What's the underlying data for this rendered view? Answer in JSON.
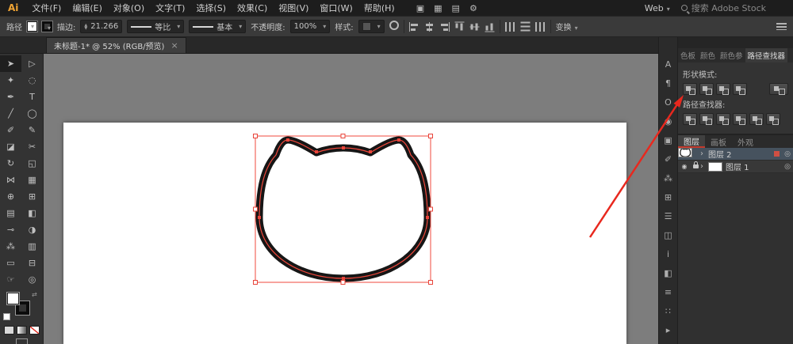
{
  "app": {
    "logo": "Ai"
  },
  "menubar": {
    "items": [
      "文件(F)",
      "编辑(E)",
      "对象(O)",
      "文字(T)",
      "选择(S)",
      "效果(C)",
      "视图(V)",
      "窗口(W)",
      "帮助(H)"
    ],
    "icons": [
      {
        "name": "launch-bridge-icon",
        "glyph": "▣"
      },
      {
        "name": "adobe-stock-icon",
        "glyph": "▦"
      },
      {
        "name": "arrange-documents-icon",
        "glyph": "▤"
      },
      {
        "name": "gpu-performance-icon",
        "glyph": "⚙"
      }
    ],
    "workspace": "Web",
    "search_text": "搜索 Adobe Stock"
  },
  "controlbar": {
    "selection_label": "路径",
    "stroke_label": "描边:",
    "stroke_value": "21.266",
    "width_profile": "等比",
    "brush_def": "基本",
    "opacity_label": "不透明度:",
    "opacity_value": "100%",
    "style_label": "样式:",
    "transform_label": "变换"
  },
  "tabbar": {
    "title": "未标题-1* @ 52% (RGB/预览)",
    "close": "×"
  },
  "tools": [
    {
      "name": "selection-tool",
      "glyph": "➤"
    },
    {
      "name": "direct-selection-tool",
      "glyph": "▷"
    },
    {
      "name": "magic-wand-tool",
      "glyph": "✦"
    },
    {
      "name": "lasso-tool",
      "glyph": "◌"
    },
    {
      "name": "pen-tool",
      "glyph": "✒"
    },
    {
      "name": "type-tool",
      "glyph": "T"
    },
    {
      "name": "line-segment-tool",
      "glyph": "╱"
    },
    {
      "name": "ellipse-tool",
      "glyph": "◯"
    },
    {
      "name": "paintbrush-tool",
      "glyph": "✐"
    },
    {
      "name": "pencil-tool",
      "glyph": "✎"
    },
    {
      "name": "eraser-tool",
      "glyph": "◪"
    },
    {
      "name": "scissors-tool",
      "glyph": "✂"
    },
    {
      "name": "rotate-tool",
      "glyph": "↻"
    },
    {
      "name": "scale-tool",
      "glyph": "◱"
    },
    {
      "name": "width-tool",
      "glyph": "⋈"
    },
    {
      "name": "free-transform-tool",
      "glyph": "▦"
    },
    {
      "name": "shape-builder-tool",
      "glyph": "⊕"
    },
    {
      "name": "perspective-grid-tool",
      "glyph": "⊞"
    },
    {
      "name": "mesh-tool",
      "glyph": "▤"
    },
    {
      "name": "gradient-tool",
      "glyph": "◧"
    },
    {
      "name": "eyedropper-tool",
      "glyph": "⊸"
    },
    {
      "name": "blend-tool",
      "glyph": "◑"
    },
    {
      "name": "symbol-sprayer-tool",
      "glyph": "⁂"
    },
    {
      "name": "column-graph-tool",
      "glyph": "▥"
    },
    {
      "name": "artboard-tool",
      "glyph": "▭"
    },
    {
      "name": "slice-tool",
      "glyph": "⊟"
    },
    {
      "name": "hand-tool",
      "glyph": "☞"
    },
    {
      "name": "zoom-tool",
      "glyph": "◎"
    }
  ],
  "dock_icons": [
    {
      "name": "character-panel-icon",
      "glyph": "A"
    },
    {
      "name": "paragraph-panel-icon",
      "glyph": "¶"
    },
    {
      "name": "opentype-panel-icon",
      "glyph": "O"
    },
    {
      "name": "appearance-panel-icon",
      "glyph": "◉"
    },
    {
      "name": "graphic-styles-panel-icon",
      "glyph": "▣"
    },
    {
      "name": "brushes-panel-icon",
      "glyph": "✐"
    },
    {
      "name": "symbols-panel-icon",
      "glyph": "⁂"
    },
    {
      "name": "transform-panel-icon",
      "glyph": "⊞"
    },
    {
      "name": "align-panel-icon",
      "glyph": "☰"
    },
    {
      "name": "pathfinder-panel-icon",
      "glyph": "◫"
    },
    {
      "name": "info-panel-icon",
      "glyph": "i"
    },
    {
      "name": "gradient-panel-icon",
      "glyph": "◧"
    },
    {
      "name": "stroke-panel-icon",
      "glyph": "≡"
    },
    {
      "name": "swatches-panel-icon",
      "glyph": "∷"
    },
    {
      "name": "libraries-panel-icon",
      "glyph": "▸"
    }
  ],
  "panels": {
    "tabs": [
      {
        "label": "色板",
        "active": false
      },
      {
        "label": "颜色",
        "active": false
      },
      {
        "label": "颜色参",
        "active": false
      },
      {
        "label": "路径查找器",
        "active": true
      }
    ],
    "shape_modes_label": "形状模式:",
    "pathfinder_label": "路径查找器:",
    "shape_mode_buttons": [
      {
        "name": "shape-mode-unite-button"
      },
      {
        "name": "shape-mode-minus-front-button"
      },
      {
        "name": "shape-mode-intersect-button"
      },
      {
        "name": "shape-mode-exclude-button"
      }
    ],
    "pathfinder_buttons": [
      {
        "name": "pathfinder-divide-button"
      },
      {
        "name": "pathfinder-trim-button"
      },
      {
        "name": "pathfinder-merge-button"
      },
      {
        "name": "pathfinder-crop-button"
      },
      {
        "name": "pathfinder-outline-button"
      },
      {
        "name": "pathfinder-minus-back-button"
      }
    ],
    "layers_tabs": [
      {
        "label": "图层",
        "active": true
      },
      {
        "label": "画板",
        "active": false
      },
      {
        "label": "外观",
        "active": false
      }
    ],
    "layers": [
      {
        "name": "图层 2",
        "selected": true,
        "locked": false,
        "has_art": true
      },
      {
        "name": "图层 1",
        "selected": false,
        "locked": true,
        "has_art": false
      }
    ]
  },
  "annotation": {
    "color": "#e8281e"
  },
  "colors": {
    "selection": "#f0483c"
  }
}
